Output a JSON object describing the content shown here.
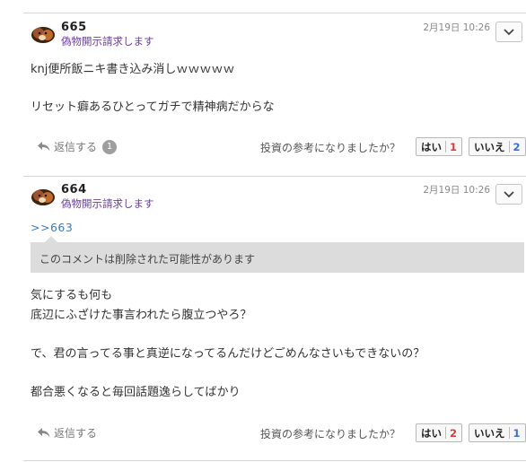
{
  "question": "投資の参考になりましたか？",
  "reply_label": "返信する",
  "report_label": "偽物開示請求します",
  "yes_label": "はい",
  "no_label": "いいえ",
  "comments": [
    {
      "number": "665",
      "date": "2月19日 10:26",
      "anchor": "",
      "deleted_notice": "",
      "lines": [
        "knj便所飯ニキ書き込み消しｗｗｗｗｗ",
        "",
        "リセット癖あるひとってガチで精神病だからな"
      ],
      "reply_count": "1",
      "yes_count": "1",
      "no_count": "2"
    },
    {
      "number": "664",
      "date": "2月19日 10:26",
      "anchor": ">>663",
      "deleted_notice": "このコメントは削除された可能性があります",
      "lines": [
        "気にするも何も",
        "底辺にふざけた事言われたら腹立つやろ？",
        "",
        "で、君の言ってる事と真逆になってるんだけどごめんなさいもできないの？",
        "",
        "都合悪くなると毎回話題逸らしてばかり"
      ],
      "reply_count": "",
      "yes_count": "2",
      "no_count": "1"
    }
  ],
  "colors": {
    "report": "#6a3f9a",
    "anchor": "#3a7bbd",
    "yes_count": "#d23c3c",
    "no_count": "#3a6fcf"
  },
  "icons": {
    "avatar": "cat-avatar-icon",
    "menu": "chevron-down-icon",
    "reply": "reply-arrow-icon"
  }
}
